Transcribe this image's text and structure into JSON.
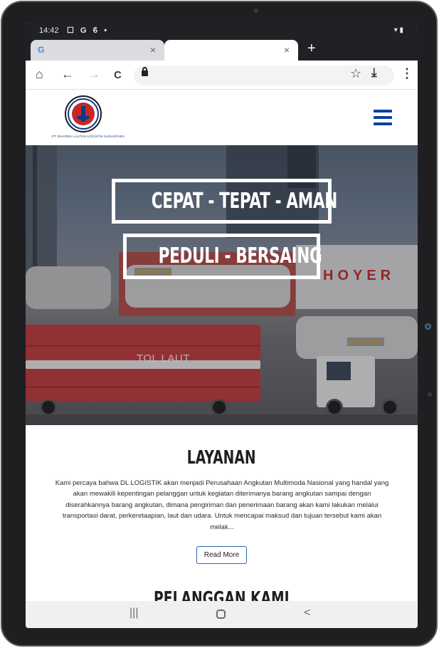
{
  "status_bar": {
    "time": "14:42",
    "icons": "☐ G ϐ •",
    "right_icons": "▾ ▮"
  },
  "browser": {
    "tabs": [
      {
        "favicon": "G",
        "close": "×",
        "active": false
      },
      {
        "favicon": "",
        "close": "×",
        "active": true
      }
    ],
    "new_tab_label": "+",
    "toolbar": {
      "home_icon": "⌂",
      "back_icon": "←",
      "forward_icon": "→",
      "reload_icon": "C",
      "star_icon": "☆",
      "download_icon": "⤓",
      "menu_icon": "⋮",
      "url": ""
    }
  },
  "site": {
    "logo_caption": "PT DHARMA LAUTAN LOGISTIK NUSANTARA",
    "hero": {
      "tagline_1": "CEPAT - TEPAT - AMAN",
      "tagline_2": "PEDULI - BERSAING",
      "photo_text_tol_laut": "TOL LAUT",
      "photo_text_hoyer": "HOYER",
      "photo_text_bertschi_1": "BERTSCHI",
      "photo_text_bertschi_2": "BERTSCHI"
    },
    "layanan": {
      "title": "LAYANAN",
      "text": "Kami percaya bahwa DL LOGISTIK akan menjadi Perusahaan Angkutan Multimoda Nasional yang handal yang akan mewakili kepentingan pelanggan untuk kegiatan diterimanya barang angkutan sampai dengan diserahkannya barang angkutan, dimana pengiriman dan penerimaan barang akan kami lakukan melalui transportasi darat, perkeretaapian, laut dan udara. Untuk mencapai maksud dan tujuan tersebut kami akan melak...",
      "button": "Read More"
    },
    "pelanggan": {
      "title": "PELANGGAN KAMI"
    }
  },
  "android_nav": {
    "recents": "|||",
    "back": "<"
  }
}
